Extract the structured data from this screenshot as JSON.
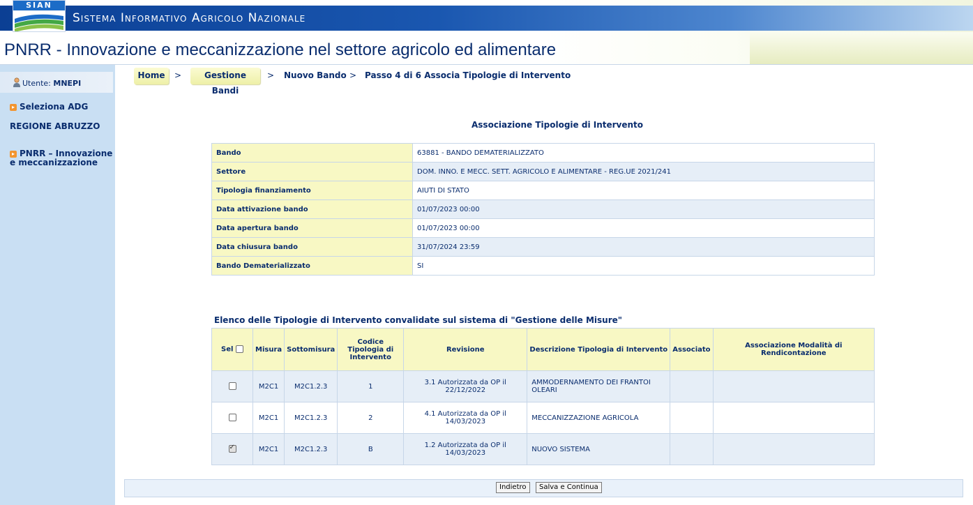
{
  "header": {
    "logo_text": "SIAN",
    "app_title": "Sistema Informativo Agricolo Nazionale",
    "page_title": "PNRR - Innovazione e meccanizzazione nel settore agricolo ed alimentare"
  },
  "sidebar": {
    "user_prefix": "Utente:",
    "user_name": "MNEPI",
    "select_adg": "Seleziona ADG",
    "region": "REGIONE ABRUZZO",
    "pnrr_link": "PNRR – Innovazione e meccanizzazione"
  },
  "breadcrumb": {
    "home": "Home",
    "gestione_bandi": "Gestione Bandi",
    "nuovo_bando": "Nuovo Bando",
    "step": "Passo 4 di 6 Associa Tipologie di Intervento",
    "sep": ">"
  },
  "section_title": "Associazione Tipologie di Intervento",
  "info": {
    "rows": [
      {
        "label": "Bando",
        "value": "63881 - BANDO DEMATERIALIZZATO"
      },
      {
        "label": "Settore",
        "value": "DOM. INNO. E MECC. SETT. AGRICOLO E ALIMENTARE - REG.UE 2021/241"
      },
      {
        "label": "Tipologia finanziamento",
        "value": "AIUTI DI STATO"
      },
      {
        "label": "Data attivazione bando",
        "value": "01/07/2023 00:00"
      },
      {
        "label": "Data apertura bando",
        "value": "01/07/2023 00:00"
      },
      {
        "label": "Data chiusura bando",
        "value": "31/07/2024 23:59"
      },
      {
        "label": "Bando Dematerializzato",
        "value": "SI"
      }
    ]
  },
  "list": {
    "title": "Elenco delle Tipologie di Intervento convalidate sul sistema di \"Gestione delle Misure\"",
    "headers": {
      "sel": "Sel",
      "misura": "Misura",
      "sottomisura": "Sottomisura",
      "codice": "Codice Tipologia di Intervento",
      "revisione": "Revisione",
      "descrizione": "Descrizione Tipologia di Intervento",
      "associato": "Associato",
      "modalita": "Associazione Modalità di Rendicontazione"
    },
    "rows": [
      {
        "checked": false,
        "misura": "M2C1",
        "sottomisura": "M2C1.2.3",
        "codice": "1",
        "revisione": "3.1 Autorizzata da OP il 22/12/2022",
        "descrizione": "AMMODERNAMENTO DEI FRANTOI OLEARI",
        "associato": "",
        "modalita": ""
      },
      {
        "checked": false,
        "misura": "M2C1",
        "sottomisura": "M2C1.2.3",
        "codice": "2",
        "revisione": "4.1 Autorizzata da OP il 14/03/2023",
        "descrizione": "MECCANIZZAZIONE AGRICOLA",
        "associato": "",
        "modalita": ""
      },
      {
        "checked": true,
        "misura": "M2C1",
        "sottomisura": "M2C1.2.3",
        "codice": "B",
        "revisione": "1.2 Autorizzata da OP il 14/03/2023",
        "descrizione": "NUOVO SISTEMA",
        "associato": "",
        "modalita": ""
      }
    ]
  },
  "footer": {
    "back_label": "Indietro",
    "save_label": "Salva e Continua"
  },
  "colors": {
    "header_blue": "#0b3f94",
    "sidebar_bg": "#c9dff3",
    "label_yellow": "#f8f8c4",
    "text_navy": "#0a2d6e"
  }
}
